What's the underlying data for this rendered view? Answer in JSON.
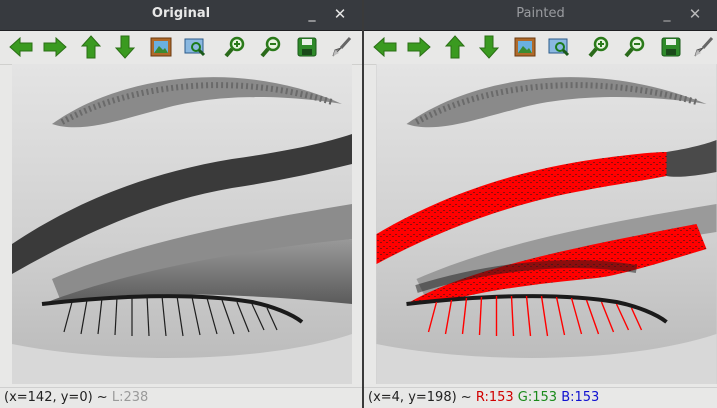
{
  "windows": [
    {
      "title": "Original",
      "status": {
        "coords": "(x=142, y=0) ~ ",
        "value": "L:238"
      }
    },
    {
      "title": "Painted",
      "status": {
        "coords": "(x=4, y=198) ~ ",
        "r": "R:153",
        "g": "G:153",
        "b": "B:153"
      }
    }
  ],
  "window_controls": {
    "minimize": "_",
    "close": "✕"
  },
  "toolbar_icons": [
    "arrow-left-icon",
    "arrow-right-icon",
    "arrow-up-icon",
    "arrow-down-icon",
    "image-icon",
    "zoom-region-icon",
    "zoom-in-icon",
    "zoom-out-icon",
    "save-icon",
    "brush-icon"
  ],
  "colors": {
    "paint": "#ff0000",
    "arrow": "#3a9a20",
    "titlebar": "#373a3f"
  }
}
